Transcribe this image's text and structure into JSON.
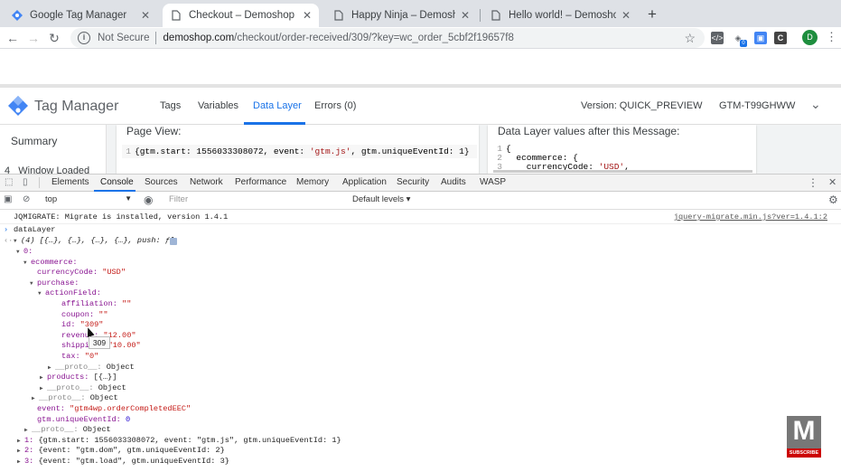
{
  "browser": {
    "tabs": [
      {
        "title": "Google Tag Manager",
        "icon": "gtm-diamond-icon",
        "active": false
      },
      {
        "title": "Checkout – Demoshop",
        "icon": "page-icon",
        "active": true
      },
      {
        "title": "Happy Ninja – Demoshop",
        "icon": "page-icon",
        "active": false
      },
      {
        "title": "Hello world! – Demoshop",
        "icon": "page-icon",
        "active": false
      }
    ],
    "new_tab": "+",
    "address": {
      "security": "Not Secure",
      "domain": "demoshop.com",
      "path": "/checkout/order-received/309/?key=wc_order_5cbf2f19657f8"
    },
    "profile_initial": "D",
    "ext_badge": "0",
    "ext_c": "C"
  },
  "gtm": {
    "product": "Tag Manager",
    "nav": [
      "Tags",
      "Variables",
      "Data Layer",
      "Errors (0)"
    ],
    "active_nav": "Data Layer",
    "version": "Version: QUICK_PREVIEW",
    "container_id": "GTM-T99GHWW",
    "sidebar": [
      "Summary",
      "4   Window Loaded"
    ],
    "page_view": {
      "title": "Page View:",
      "line_no": "1",
      "code_prefix": "{gtm.start: 1556033308072, event: ",
      "code_event": "'gtm.js'",
      "code_suffix": ", gtm.uniqueEventId: 1}"
    },
    "dl_values": {
      "title": "Data Layer values after this Message:",
      "lines": [
        {
          "n": "1",
          "text": "{"
        },
        {
          "n": "2",
          "text": "  ecommerce: {"
        },
        {
          "n": "3",
          "text": "    currencyCode: ",
          "str": "'USD'",
          "tail": ","
        }
      ]
    }
  },
  "devtools": {
    "tabs": [
      "Elements",
      "Console",
      "Sources",
      "Network",
      "Performance",
      "Memory",
      "Application",
      "Security",
      "Audits",
      "WASP"
    ],
    "active_tab": "Console",
    "context": "top",
    "filter_placeholder": "Filter",
    "levels": "Default levels ▾",
    "jqmigrate": "JQMIGRATE: Migrate is installed, version 1.4.1",
    "jqmigrate_src": "jquery-migrate.min.js?ver=1.4.1:2",
    "input": "dataLayer",
    "summary": "(4) [{…}, {…}, {…}, {…}, push: ƒ]",
    "tooltip": "309",
    "rows": [
      {
        "prefix": "0:",
        "rest": ""
      },
      {
        "prefix": "ecommerce:",
        "rest": ""
      },
      {
        "prefix": "currencyCode: ",
        "rest": "\"USD\""
      },
      {
        "prefix": "purchase:",
        "rest": ""
      },
      {
        "prefix": "actionField:",
        "rest": ""
      },
      {
        "prefix": "affiliation: ",
        "rest": "\"\""
      },
      {
        "prefix": "coupon: ",
        "rest": "\"\""
      },
      {
        "prefix": "id: ",
        "rest": "\"309\""
      },
      {
        "prefix": "revenue: ",
        "rest": "\"12.00\""
      },
      {
        "prefix": "shipping: ",
        "rest": "\"10.00\""
      },
      {
        "prefix": "tax: ",
        "rest": "\"0\""
      },
      {
        "prefix": "__proto__: ",
        "rest": "Object"
      },
      {
        "prefix": "products: ",
        "rest": "[{…}]"
      },
      {
        "prefix": "__proto__: ",
        "rest": "Object"
      },
      {
        "prefix": "__proto__: ",
        "rest": "Object"
      },
      {
        "prefix": "event: ",
        "rest": "\"gtm4wp.orderCompletedEEC\""
      },
      {
        "prefix": "gtm.uniqueEventId: ",
        "rest": "0"
      },
      {
        "prefix": "__proto__: ",
        "rest": "Object"
      },
      {
        "prefix": "1: ",
        "rest": "{gtm.start: 1556033308072, event: \"gtm.js\", gtm.uniqueEventId: 1}"
      },
      {
        "prefix": "2: ",
        "rest": "{event: \"gtm.dom\", gtm.uniqueEventId: 2}"
      },
      {
        "prefix": "3: ",
        "rest": "{event: \"gtm.load\", gtm.uniqueEventId: 3}"
      }
    ]
  },
  "watermark": {
    "letter": "M",
    "label": "SUBSCRIBE"
  },
  "colors": {
    "accent": "#1a73e8",
    "gtm_blue": "#4285f4",
    "string": "#c41a16",
    "key": "#881391"
  }
}
